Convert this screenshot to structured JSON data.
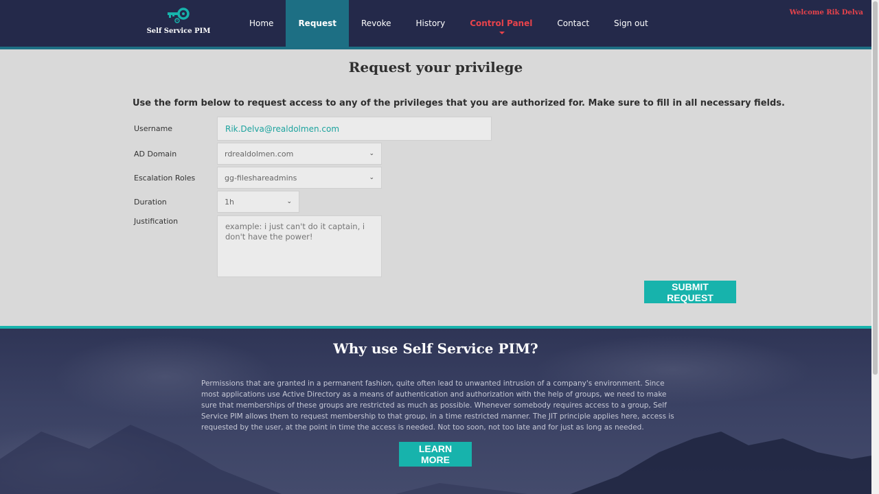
{
  "header": {
    "logo_text": "Self Service PIM",
    "welcome": "Welcome Rik Delva",
    "nav": [
      {
        "label": "Home"
      },
      {
        "label": "Request"
      },
      {
        "label": "Revoke"
      },
      {
        "label": "History"
      },
      {
        "label": "Control Panel"
      },
      {
        "label": "Contact"
      },
      {
        "label": "Sign out"
      }
    ],
    "active_nav": "Request"
  },
  "form": {
    "title": "Request your privilege",
    "intro": "Use the form below to request access to any of the privileges that you are authorized for. Make sure to fill in all necessary fields.",
    "username": {
      "label": "Username",
      "value": "Rik.Delva@realdolmen.com"
    },
    "ad_domain": {
      "label": "AD Domain",
      "value": "rdrealdolmen.com"
    },
    "escalation_roles": {
      "label": "Escalation Roles",
      "value": "gg-fileshareadmins"
    },
    "duration": {
      "label": "Duration",
      "value": "1h"
    },
    "justification": {
      "label": "Justification",
      "placeholder": "example: i just can't do it captain, i don't have the power!"
    },
    "submit_label": "SUBMIT REQUEST"
  },
  "why": {
    "title": "Why use Self Service PIM?",
    "text": "Permissions that are granted in a permanent fashion, quite often lead to unwanted intrusion of a company's environment. Since most applications use Active Directory as a means of authentication and authorization with the help of groups, we need to make sure that memberships of these groups are restricted as much as possible. Whenever somebody requires access to a group, Self Service PIM allows them to request membership to that group, in a time restricted manner. The JIT principle applies here, access is requested by the user, at the point in time the access is needed. Not too soon, not too late and for just as long as needed.",
    "button_label": "LEARN MORE"
  },
  "colors": {
    "header_bg": "#24294a",
    "accent": "#17b3ac",
    "active_tab": "#1d6f84",
    "highlight": "#e8434b"
  },
  "icons": {
    "logo": "key-icon",
    "select_chevron": "chevron-down-icon"
  }
}
